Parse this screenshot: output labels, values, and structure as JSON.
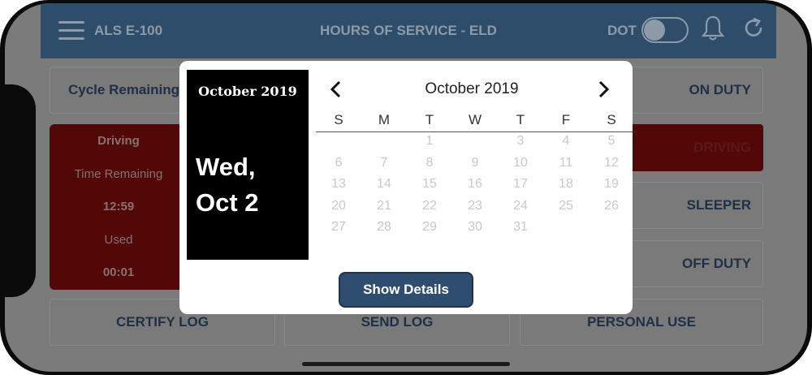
{
  "header": {
    "app_name": "ALS E-100",
    "title": "HOURS OF SERVICE - ELD",
    "dot_label": "DOT"
  },
  "background": {
    "cycle_remaining": "Cycle Remaining",
    "on_duty": "ON DUTY",
    "driving": "DRIVING",
    "sleeper": "SLEEPER",
    "off_duty": "OFF DUTY",
    "certify_log": "CERTIFY LOG",
    "send_log": "SEND LOG",
    "personal_use": "PERSONAL USE",
    "card": {
      "title": "Driving",
      "time_remaining_label": "Time Remaining",
      "time_remaining": "12:59",
      "used_label": "Used",
      "used": "00:01"
    }
  },
  "date_panel": {
    "month_year": "October 2019",
    "weekday": "Wed,",
    "date": "Oct 2"
  },
  "calendar": {
    "title": "October 2019",
    "weekdays": [
      "S",
      "M",
      "T",
      "W",
      "T",
      "F",
      "S"
    ],
    "rows": [
      [
        "",
        "",
        "1",
        "",
        "3",
        "4",
        "5"
      ],
      [
        "6",
        "7",
        "8",
        "9",
        "10",
        "11",
        "12"
      ],
      [
        "13",
        "14",
        "15",
        "16",
        "17",
        "18",
        "19"
      ],
      [
        "20",
        "21",
        "22",
        "23",
        "24",
        "25",
        "26"
      ],
      [
        "27",
        "28",
        "29",
        "30",
        "31",
        "",
        ""
      ]
    ]
  },
  "actions": {
    "show_details": "Show Details"
  }
}
